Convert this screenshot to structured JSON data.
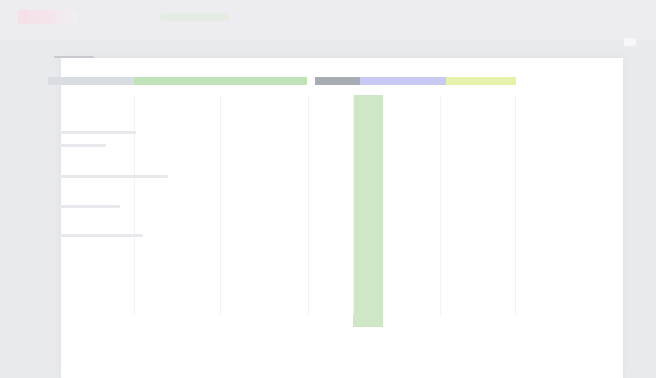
{
  "app": {
    "title": "",
    "accent_color": "#cfe6c7"
  },
  "document": {
    "heading": "",
    "column_band_colors": [
      "#d9dde2",
      "#bfe3b6",
      "#bfe3b6",
      "#a7acb5",
      "#c8c9f2",
      "#e7f1a9"
    ],
    "notes": [
      "",
      ""
    ]
  }
}
